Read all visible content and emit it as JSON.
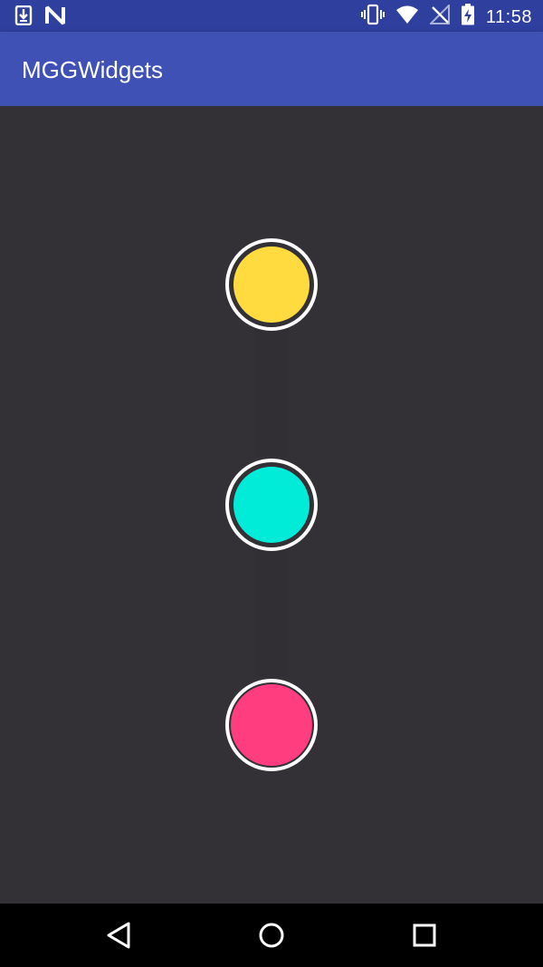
{
  "status_bar": {
    "left_icons": [
      "download-icon",
      "n-notification-icon"
    ],
    "right_icons": [
      "vibrate-icon",
      "wifi-icon",
      "no-signal-icon",
      "battery-charging-icon"
    ],
    "time": "11:58"
  },
  "app_bar": {
    "title": "MGGWidgets",
    "color": "#3f51b5"
  },
  "content": {
    "background": "#333135",
    "circles": [
      {
        "name": "yellow-circle",
        "color": "#ffdb40"
      },
      {
        "name": "cyan-circle",
        "color": "#00ecd8"
      },
      {
        "name": "pink-circle",
        "color": "#ff3d7f"
      }
    ]
  },
  "nav_bar": {
    "buttons": [
      "back-icon",
      "home-icon",
      "recents-icon"
    ]
  }
}
